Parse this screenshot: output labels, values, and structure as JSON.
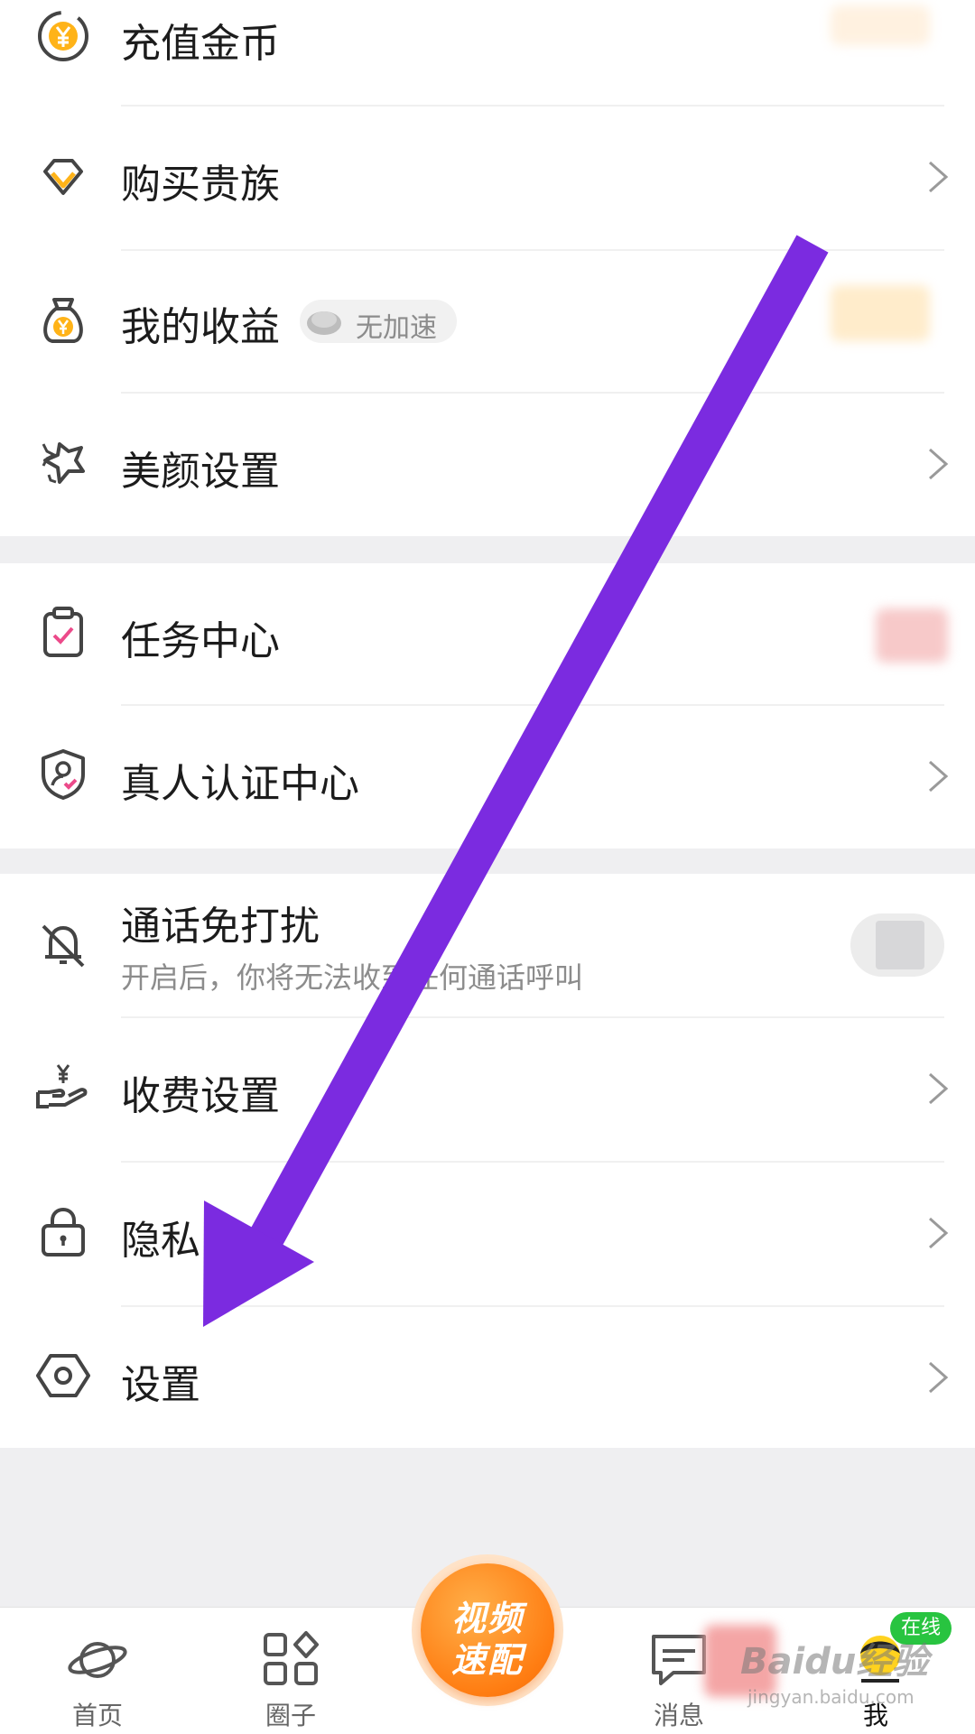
{
  "menu": {
    "recharge": {
      "label": "充值金币",
      "icon": "coin-yen-icon"
    },
    "buy_noble": {
      "label": "购买贵族",
      "icon": "diamond-icon"
    },
    "earnings": {
      "label": "我的收益",
      "icon": "money-bag-icon",
      "pill": "无加速"
    },
    "beauty": {
      "label": "美颜设置",
      "icon": "sparkle-icon"
    },
    "tasks": {
      "label": "任务中心",
      "icon": "clipboard-check-icon"
    },
    "verify": {
      "label": "真人认证中心",
      "icon": "shield-user-icon"
    },
    "dnd": {
      "label": "通话免打扰",
      "sub": "开启后，你将无法收到任何通话呼叫",
      "icon": "bell-off-icon",
      "toggle_on": false
    },
    "fee": {
      "label": "收费设置",
      "icon": "hand-yen-icon"
    },
    "privacy": {
      "label": "隐私",
      "icon": "lock-icon"
    },
    "settings": {
      "label": "设置",
      "icon": "hexagon-gear-icon"
    }
  },
  "tabbar": {
    "home": "首页",
    "circle": "圈子",
    "center_line1": "视频",
    "center_line2": "速配",
    "messages": "消息",
    "me": "我",
    "online_badge": "在线"
  },
  "watermark": {
    "brand": "Baidu经验",
    "url": "jingyan.baidu.com"
  },
  "colors": {
    "accent_orange": "#ff7d12",
    "arrow_purple": "#7b2be0",
    "online_green": "#28c440"
  }
}
